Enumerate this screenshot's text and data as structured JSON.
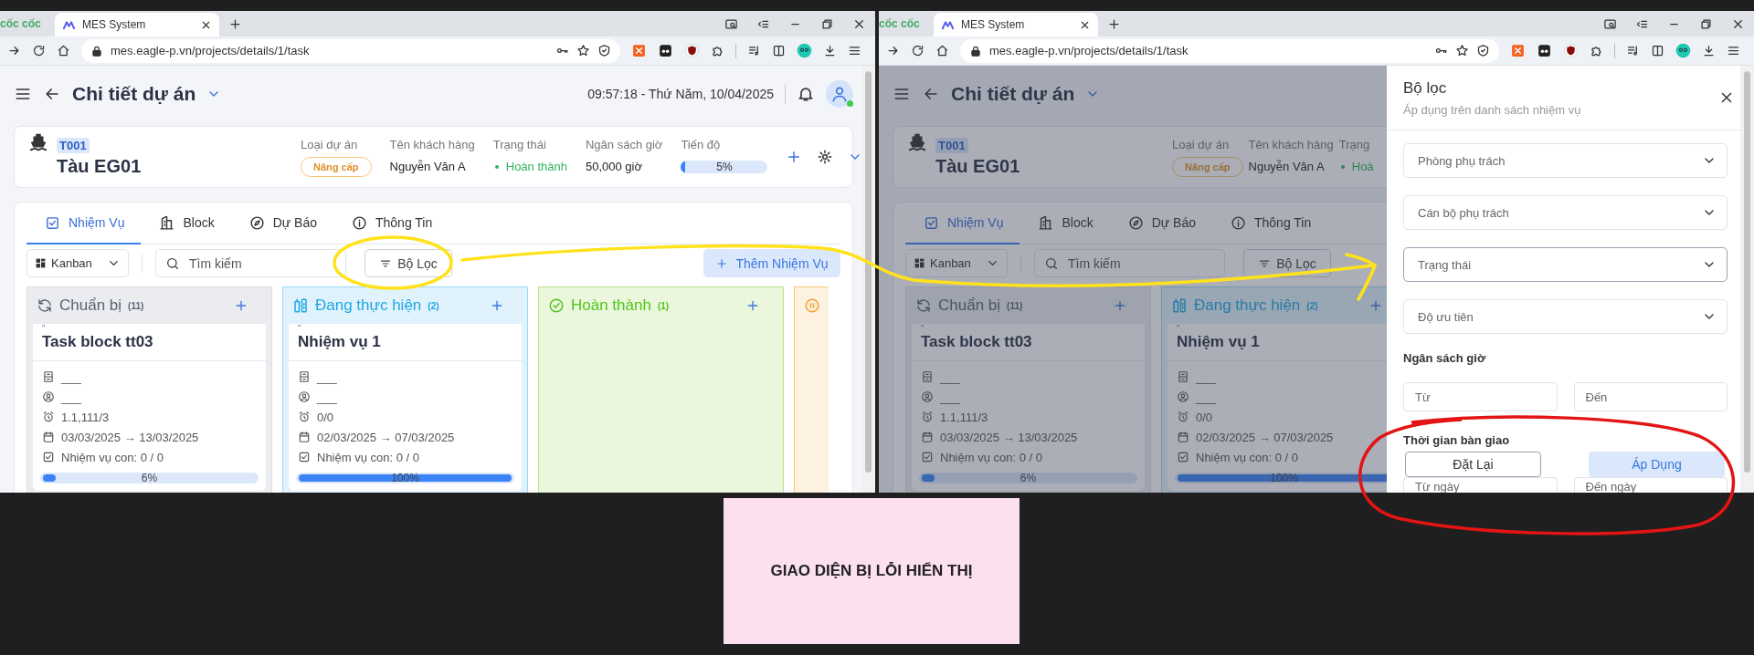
{
  "windows": [
    {
      "browser": {
        "brand": "cốc cốc",
        "tab_title": "MES System",
        "url": "mes.eagle-p.vn/projects/details/1/task"
      },
      "page": {
        "header": {
          "title": "Chi tiết dự án",
          "datetime": "09:57:18 - Thứ Năm, 10/04/2025"
        },
        "project": {
          "code": "T001",
          "name": "Tàu EG01",
          "actions": [
            {
              "kind": "add"
            },
            {
              "kind": "settings"
            },
            {
              "kind": "expand"
            }
          ],
          "fields": [
            {
              "label": "Loại dự án",
              "kind": "badge",
              "value": "Nâng cấp"
            },
            {
              "label": "Tên khách hàng",
              "kind": "text",
              "value": "Nguyễn Văn A"
            },
            {
              "label": "Trạng thái",
              "kind": "status",
              "value": "Hoàn thành"
            },
            {
              "label": "Ngân sách giờ",
              "kind": "text",
              "value": "50,000 giờ"
            },
            {
              "label": "Tiến độ",
              "kind": "progress",
              "value": "5%",
              "level": 0.05
            }
          ]
        },
        "tabs": [
          {
            "label": "Nhiệm Vụ",
            "kind": "tasks",
            "selected": true
          },
          {
            "label": "Block",
            "kind": "block",
            "selected": false
          },
          {
            "label": "Dự Báo",
            "kind": "forecast",
            "selected": false
          },
          {
            "label": "Thông Tin",
            "kind": "info",
            "selected": false
          }
        ],
        "toolbar": {
          "view": "Kanban",
          "search_placeholder": "Tìm kiếm",
          "filter_button": "Bộ Lọc",
          "add_button": "Thêm Nhiệm Vụ"
        },
        "columns": [
          {
            "kind": "prepare",
            "title": "Chuẩn bị",
            "count": "(11)",
            "cards": [
              {
                "mark": "″",
                "title": "Task block tt03",
                "rows": [
                  {
                    "kind": "department",
                    "text": "___"
                  },
                  {
                    "kind": "person",
                    "text": "___"
                  },
                  {
                    "kind": "time",
                    "text": "1.1,111/3"
                  },
                  {
                    "kind": "date",
                    "text": "03/03/2025 → 13/03/2025"
                  },
                  {
                    "kind": "subtasks",
                    "text": "Nhiệm vụ con: 0 / 0"
                  }
                ],
                "progress": {
                  "level": 0.06,
                  "text": "6%"
                }
              }
            ]
          },
          {
            "kind": "doing",
            "title": "Đang thực hiện",
            "count": "(2)",
            "cards": [
              {
                "mark": "″",
                "title": "Nhiệm vụ 1",
                "rows": [
                  {
                    "kind": "department",
                    "text": "___"
                  },
                  {
                    "kind": "person",
                    "text": "___"
                  },
                  {
                    "kind": "time",
                    "text": "0/0"
                  },
                  {
                    "kind": "date",
                    "text": "02/03/2025 → 07/03/2025"
                  },
                  {
                    "kind": "subtasks",
                    "text": "Nhiệm vụ con: 0 / 0"
                  }
                ],
                "progress": {
                  "level": 1,
                  "text": "100%"
                }
              }
            ]
          },
          {
            "kind": "done",
            "title": "Hoàn thành",
            "count": "(1)"
          },
          {
            "kind": "paused"
          }
        ]
      }
    },
    {
      "browser": {
        "brand": "cốc cốc",
        "tab_title": "MES System",
        "url": "mes.eagle-p.vn/projects/details/1/task"
      },
      "page": {
        "header": {
          "title": "Chi tiết dự án"
        },
        "project": {
          "code": "T001",
          "name": "Tàu EG01",
          "fields": [
            {
              "label": "Loại dự án",
              "kind": "badge",
              "value": "Nâng cấp"
            },
            {
              "label": "Tên khách hàng",
              "kind": "text",
              "value": "Nguyễn Văn A"
            },
            {
              "label": "Trạng",
              "kind": "status",
              "value": "Hoà"
            }
          ]
        },
        "tabs": [
          {
            "label": "Nhiệm Vụ",
            "kind": "tasks",
            "selected": true
          },
          {
            "label": "Block",
            "kind": "block",
            "selected": false
          },
          {
            "label": "Dự Báo",
            "kind": "forecast",
            "selected": false
          },
          {
            "label": "Thông Tin",
            "kind": "info",
            "selected": false
          }
        ],
        "toolbar": {
          "view": "Kanban",
          "search_placeholder": "Tìm kiếm",
          "filter_button": "Bộ Lọc"
        },
        "columns": [
          {
            "kind": "prepare",
            "title": "Chuẩn bị",
            "count": "(11)",
            "cards": [
              {
                "mark": "″",
                "title": "Task block tt03",
                "rows": [
                  {
                    "kind": "department",
                    "text": "___"
                  },
                  {
                    "kind": "person",
                    "text": "___"
                  },
                  {
                    "kind": "time",
                    "text": "1.1,111/3"
                  },
                  {
                    "kind": "date",
                    "text": "03/03/2025 → 13/03/2025"
                  },
                  {
                    "kind": "subtasks",
                    "text": "Nhiệm vụ con: 0 / 0"
                  }
                ],
                "progress": {
                  "level": 0.06,
                  "text": "6%"
                }
              }
            ]
          },
          {
            "kind": "doing",
            "title": "Đang thực hiện",
            "count": "(2)",
            "cards": [
              {
                "mark": "″",
                "title": "Nhiệm vụ 1",
                "rows": [
                  {
                    "kind": "department",
                    "text": "___"
                  },
                  {
                    "kind": "person",
                    "text": "___"
                  },
                  {
                    "kind": "time",
                    "text": "0/0"
                  },
                  {
                    "kind": "date",
                    "text": "02/03/2025 → 07/03/2025"
                  },
                  {
                    "kind": "subtasks",
                    "text": "Nhiệm vụ con: 0 / 0"
                  }
                ],
                "progress": {
                  "level": 1,
                  "text": "100%"
                }
              }
            ]
          }
        ],
        "drawer": {
          "title": "Bộ lọc",
          "subtitle": "Áp dụng trên danh sách nhiệm vụ",
          "items": [
            {
              "kind": "select",
              "placeholder": "Phòng phụ trách",
              "focused": false
            },
            {
              "kind": "select",
              "placeholder": "Cán bộ phụ trách",
              "focused": false
            },
            {
              "kind": "select",
              "placeholder": "Trạng thái",
              "focused": true
            },
            {
              "kind": "select",
              "placeholder": "Độ ưu tiên",
              "focused": false
            },
            {
              "kind": "label",
              "text": "Ngân sách giờ"
            },
            {
              "kind": "range",
              "from_placeholder": "Từ",
              "to_placeholder": "Đến"
            },
            {
              "kind": "label",
              "text": "Thời gian bàn giao"
            },
            {
              "kind": "range",
              "from_placeholder": "Từ ngày",
              "to_placeholder": "Đến ngày"
            }
          ],
          "buttons": [
            {
              "kind": "reset",
              "label": "Đặt Lại"
            },
            {
              "kind": "apply",
              "label": "Áp Dụng"
            }
          ]
        }
      }
    }
  ],
  "caption": "GIAO DIỆN BỊ LỖI HIỂN THỊ"
}
